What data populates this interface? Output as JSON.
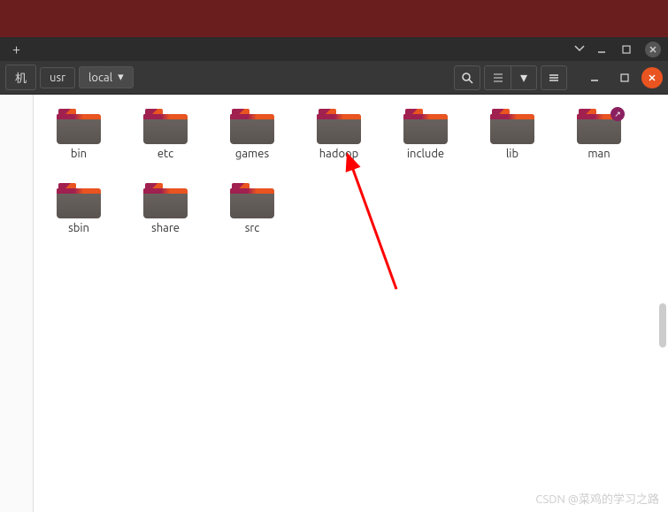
{
  "breadcrumb": [
    "机",
    "usr",
    "local"
  ],
  "folders": [
    {
      "name": "bin",
      "link": false
    },
    {
      "name": "etc",
      "link": false
    },
    {
      "name": "games",
      "link": false
    },
    {
      "name": "hadoop",
      "link": false
    },
    {
      "name": "include",
      "link": false
    },
    {
      "name": "lib",
      "link": false
    },
    {
      "name": "man",
      "link": true
    },
    {
      "name": "sbin",
      "link": false
    },
    {
      "name": "share",
      "link": false
    },
    {
      "name": "src",
      "link": false
    }
  ],
  "watermark": "CSDN @菜鸡的学习之路",
  "newtab_glyph": "+",
  "colors": {
    "accent": "#e95420",
    "folder_body": "#5a5450",
    "folder_accent": "#a02050"
  }
}
